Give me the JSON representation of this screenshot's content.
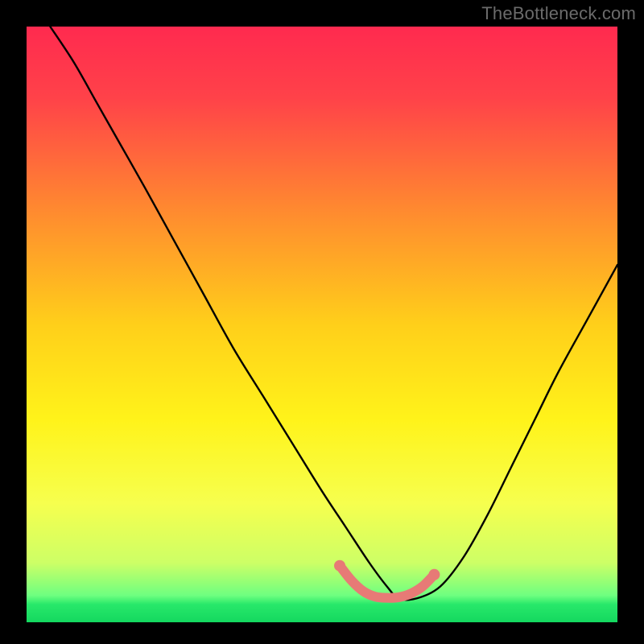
{
  "watermark": "TheBottleneck.com",
  "chart_data": {
    "type": "line",
    "title": "",
    "xlabel": "",
    "ylabel": "",
    "xlim": [
      0,
      100
    ],
    "ylim": [
      0,
      100
    ],
    "gradient_stops": [
      {
        "offset": 0,
        "color": "#ff2a4f"
      },
      {
        "offset": 0.12,
        "color": "#ff4249"
      },
      {
        "offset": 0.32,
        "color": "#ff8e2e"
      },
      {
        "offset": 0.5,
        "color": "#ffcf1a"
      },
      {
        "offset": 0.66,
        "color": "#fff31a"
      },
      {
        "offset": 0.8,
        "color": "#f6ff4e"
      },
      {
        "offset": 0.9,
        "color": "#cdff66"
      },
      {
        "offset": 0.955,
        "color": "#6eff80"
      },
      {
        "offset": 0.97,
        "color": "#28e86a"
      },
      {
        "offset": 1.0,
        "color": "#14d85f"
      }
    ],
    "series": [
      {
        "name": "bottleneck-curve",
        "color": "#000000",
        "x": [
          4,
          8,
          12,
          16,
          20,
          25,
          30,
          35,
          40,
          45,
          50,
          54,
          58,
          61,
          63,
          66,
          70,
          74,
          78,
          82,
          86,
          90,
          95,
          100
        ],
        "y": [
          100,
          94,
          87,
          80,
          73,
          64,
          55,
          46,
          38,
          30,
          22,
          16,
          10,
          6,
          4,
          4,
          6,
          11,
          18,
          26,
          34,
          42,
          51,
          60
        ]
      },
      {
        "name": "optimal-region-marker",
        "color": "#e77a76",
        "x": [
          53,
          55,
          57,
          59,
          61,
          63,
          65,
          67,
          69
        ],
        "y": [
          9.5,
          7.0,
          5.2,
          4.3,
          4.1,
          4.2,
          4.8,
          6.0,
          8.0
        ]
      }
    ]
  }
}
